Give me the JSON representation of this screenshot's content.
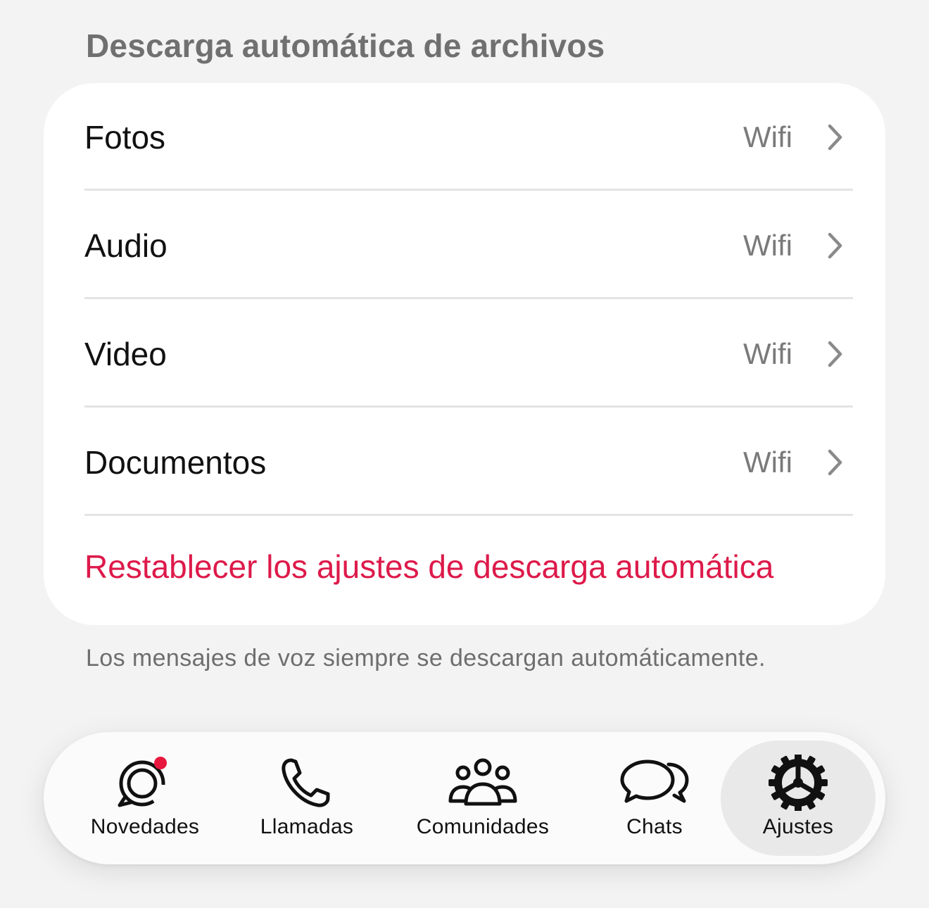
{
  "section": {
    "title": "Descarga automática de archivos"
  },
  "rows": [
    {
      "label": "Fotos",
      "value": "Wifi"
    },
    {
      "label": "Audio",
      "value": "Wifi"
    },
    {
      "label": "Video",
      "value": "Wifi"
    },
    {
      "label": "Documentos",
      "value": "Wifi"
    }
  ],
  "reset_label": "Restablecer los ajustes de descarga automática",
  "footnote": "Los mensajes de voz siempre se descargan automáticamente.",
  "tabbar": {
    "tabs": [
      {
        "label": "Novedades",
        "icon": "status-icon",
        "badge": true
      },
      {
        "label": "Llamadas",
        "icon": "phone-icon"
      },
      {
        "label": "Comunidades",
        "icon": "communities-icon"
      },
      {
        "label": "Chats",
        "icon": "chats-icon"
      },
      {
        "label": "Ajustes",
        "icon": "gear-icon",
        "active": true
      }
    ]
  },
  "colors": {
    "accent_red": "#dd1a4a",
    "badge_red": "#e8173f",
    "background": "#f3f3f3",
    "card": "#ffffff"
  }
}
